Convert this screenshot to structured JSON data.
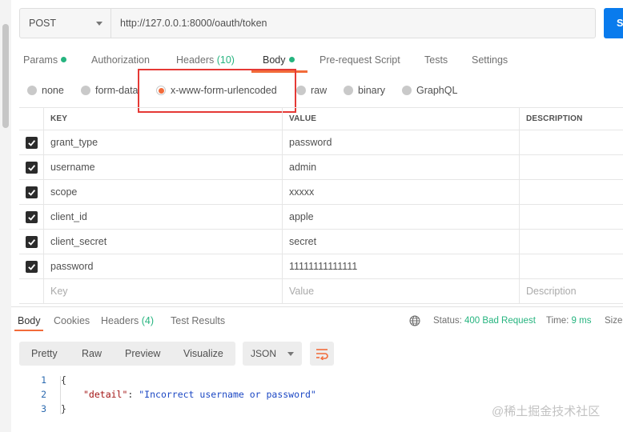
{
  "request": {
    "method": "POST",
    "url": "http://127.0.0.1:8000/oauth/token",
    "send_label": "S"
  },
  "request_tabs": {
    "params": "Params",
    "authorization": "Authorization",
    "headers": "Headers",
    "headers_count": "(10)",
    "body": "Body",
    "prerequest": "Pre-request Script",
    "tests": "Tests",
    "settings": "Settings"
  },
  "body_types": {
    "none": "none",
    "form_data": "form-data",
    "urlencoded": "x-www-form-urlencoded",
    "raw": "raw",
    "binary": "binary",
    "graphql": "GraphQL",
    "selected": "x-www-form-urlencoded"
  },
  "table": {
    "headers": {
      "key": "KEY",
      "value": "VALUE",
      "description": "DESCRIPTION"
    },
    "rows": [
      {
        "key": "grant_type",
        "value": "password",
        "checked": true
      },
      {
        "key": "username",
        "value": "admin",
        "checked": true
      },
      {
        "key": "scope",
        "value": "xxxxx",
        "checked": true
      },
      {
        "key": "client_id",
        "value": "apple",
        "checked": true
      },
      {
        "key": "client_secret",
        "value": "secret",
        "checked": true
      },
      {
        "key": "password",
        "value": "11111111111111",
        "checked": true
      }
    ],
    "placeholder": {
      "key": "Key",
      "value": "Value",
      "description": "Description"
    }
  },
  "response_tabs": {
    "body": "Body",
    "cookies": "Cookies",
    "headers": "Headers",
    "headers_count": "(4)",
    "test_results": "Test Results"
  },
  "response_meta": {
    "status_label": "Status:",
    "status_value": "400 Bad Request",
    "time_label": "Time:",
    "time_value": "9 ms",
    "size_label": "Size:"
  },
  "format_toolbar": {
    "pretty": "Pretty",
    "raw": "Raw",
    "preview": "Preview",
    "visualize": "Visualize",
    "language": "JSON"
  },
  "response_body": {
    "line_numbers": [
      "1",
      "2",
      "3"
    ],
    "open": "{",
    "key": "\"detail\"",
    "colon": ": ",
    "value": "\"Incorrect username or password\"",
    "close": "}"
  },
  "watermark": "@稀土掘金技术社区",
  "colors": {
    "accent": "#f26b3a",
    "success": "#26b47f",
    "send": "#097bed",
    "highlight": "#e53935"
  }
}
